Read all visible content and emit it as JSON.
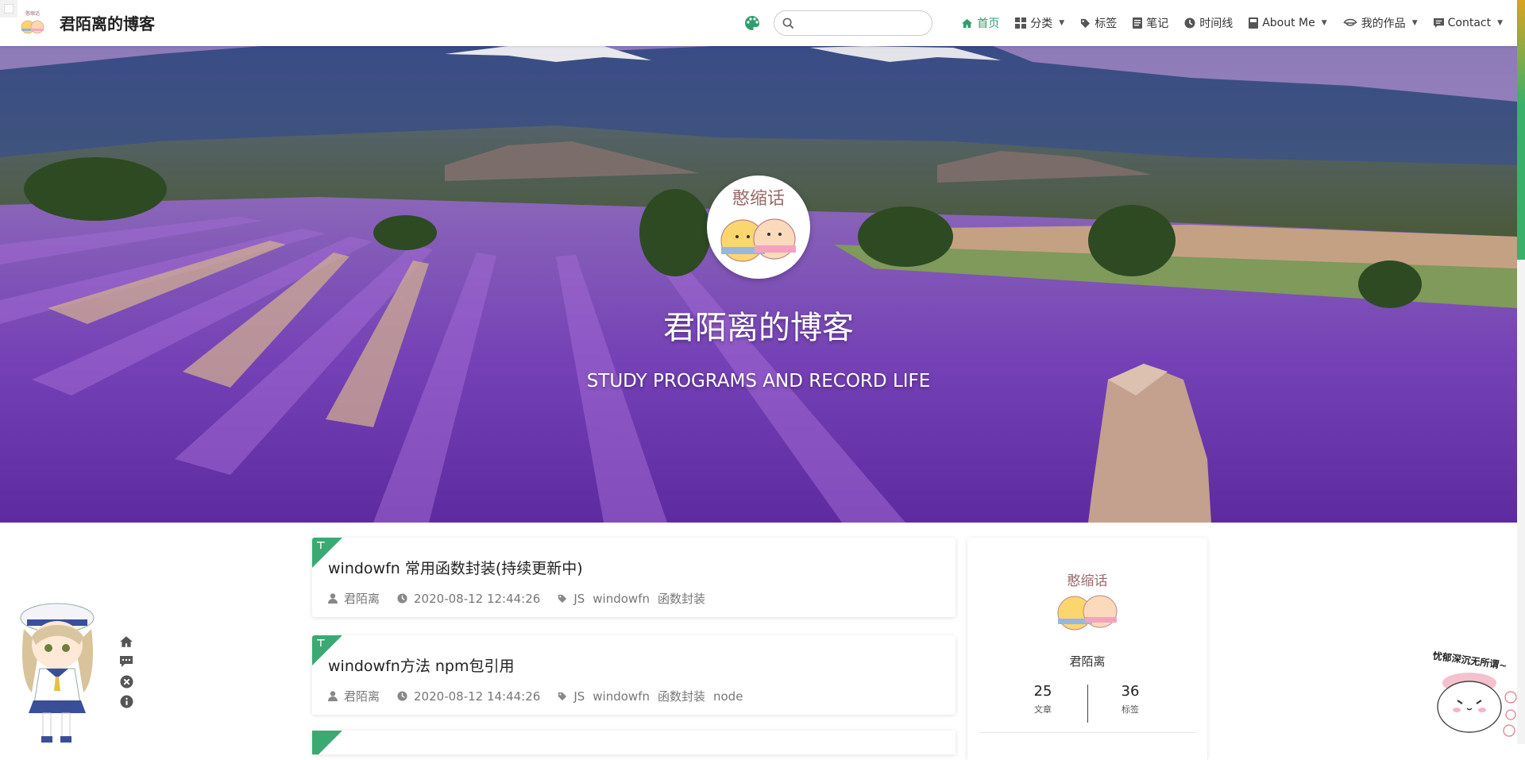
{
  "navbar": {
    "brand_title": "君陌离的博客",
    "search_placeholder": "",
    "items": [
      {
        "label": "首页",
        "icon": "home-icon",
        "active": true,
        "dropdown": false
      },
      {
        "label": "分类",
        "icon": "grid-icon",
        "active": false,
        "dropdown": true
      },
      {
        "label": "标签",
        "icon": "tag-icon",
        "active": false,
        "dropdown": false
      },
      {
        "label": "笔记",
        "icon": "note-icon",
        "active": false,
        "dropdown": false
      },
      {
        "label": "时间线",
        "icon": "clock-icon",
        "active": false,
        "dropdown": false
      },
      {
        "label": "About Me",
        "icon": "book-icon",
        "active": false,
        "dropdown": true
      },
      {
        "label": "我的作品",
        "icon": "eye-icon",
        "active": false,
        "dropdown": true
      },
      {
        "label": "Contact",
        "icon": "message-icon",
        "active": false,
        "dropdown": true
      }
    ],
    "accent_color": "#2f9e6e"
  },
  "hero": {
    "avatar_text": "憨缩话",
    "title": "君陌离的博客",
    "subtitle": "STUDY PROGRAMS AND RECORD LIFE"
  },
  "posts": [
    {
      "title": "windowfn 常用函数封装(持续更新中)",
      "author": "君陌离",
      "date": "2020-08-12 12:44:26",
      "tags": [
        "JS",
        "windowfn",
        "函数封装"
      ],
      "pinned": true
    },
    {
      "title": "windowfn方法 npm包引用",
      "author": "君陌离",
      "date": "2020-08-12 14:44:26",
      "tags": [
        "JS",
        "windowfn",
        "函数封装",
        "node"
      ],
      "pinned": true
    }
  ],
  "profile": {
    "avatar_text": "憨缩话",
    "name": "君陌离",
    "stats": [
      {
        "value": "25",
        "label": "文章"
      },
      {
        "value": "36",
        "label": "标签"
      }
    ]
  },
  "sticker": {
    "text": "忧郁深沉无所谓~"
  }
}
